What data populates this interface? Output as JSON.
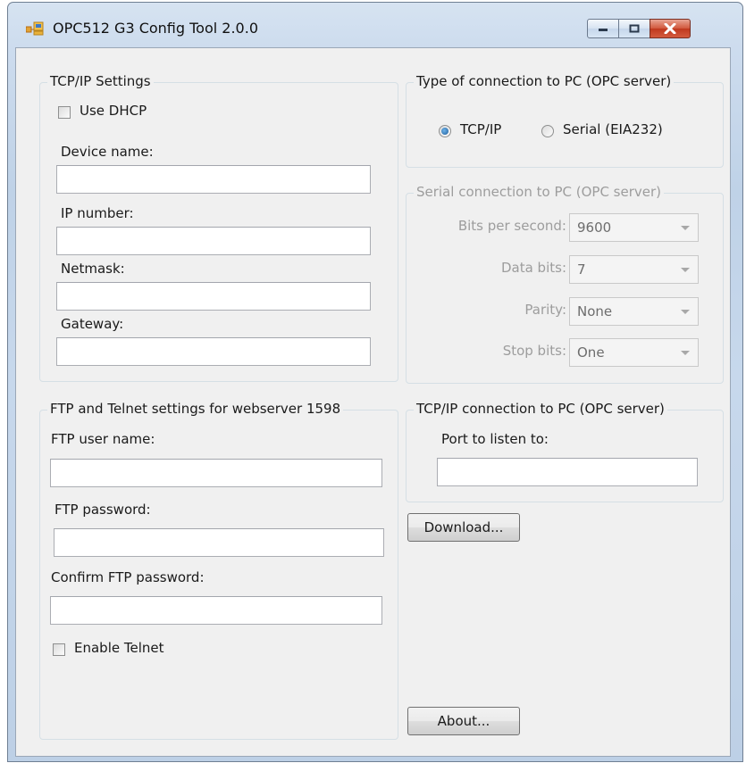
{
  "window": {
    "title": "OPC512 G3 Config Tool 2.0.0",
    "controls": {
      "minimize": "minimize-icon",
      "maximize": "maximize-icon",
      "close": "close-icon"
    }
  },
  "tcpip_settings": {
    "legend": "TCP/IP Settings",
    "use_dhcp": {
      "label": "Use DHCP",
      "checked": false
    },
    "device_name": {
      "label": "Device name:",
      "value": ""
    },
    "ip_number": {
      "label": "IP number:",
      "value": ""
    },
    "netmask": {
      "label": "Netmask:",
      "value": ""
    },
    "gateway": {
      "label": "Gateway:",
      "value": ""
    }
  },
  "connection_type": {
    "legend": "Type of connection to PC (OPC server)",
    "options": [
      {
        "label": "TCP/IP",
        "selected": true
      },
      {
        "label": "Serial (EIA232)",
        "selected": false
      }
    ]
  },
  "serial_connection": {
    "legend": "Serial connection to PC (OPC server)",
    "enabled": false,
    "fields": [
      {
        "label": "Bits per second:",
        "value": "9600"
      },
      {
        "label": "Data bits:",
        "value": "7"
      },
      {
        "label": "Parity:",
        "value": "None"
      },
      {
        "label": "Stop bits:",
        "value": "One"
      }
    ]
  },
  "ftp_settings": {
    "legend": "FTP and Telnet settings for webserver 1598",
    "user_name": {
      "label": "FTP user name:",
      "value": ""
    },
    "password": {
      "label": "FTP password:",
      "value": ""
    },
    "confirm_password": {
      "label": "Confirm FTP password:",
      "value": ""
    },
    "enable_telnet": {
      "label": "Enable Telnet",
      "checked": false
    }
  },
  "tcpip_connection": {
    "legend": "TCP/IP connection to PC (OPC server)",
    "port": {
      "label": "Port to listen to:",
      "value": ""
    }
  },
  "buttons": {
    "download": "Download...",
    "about": "About..."
  },
  "colors": {
    "window_frame": "#c7d8ec",
    "client_bg": "#f0f0f0",
    "close_button": "#c7422a",
    "radio_selected": "#1b5d9c"
  }
}
